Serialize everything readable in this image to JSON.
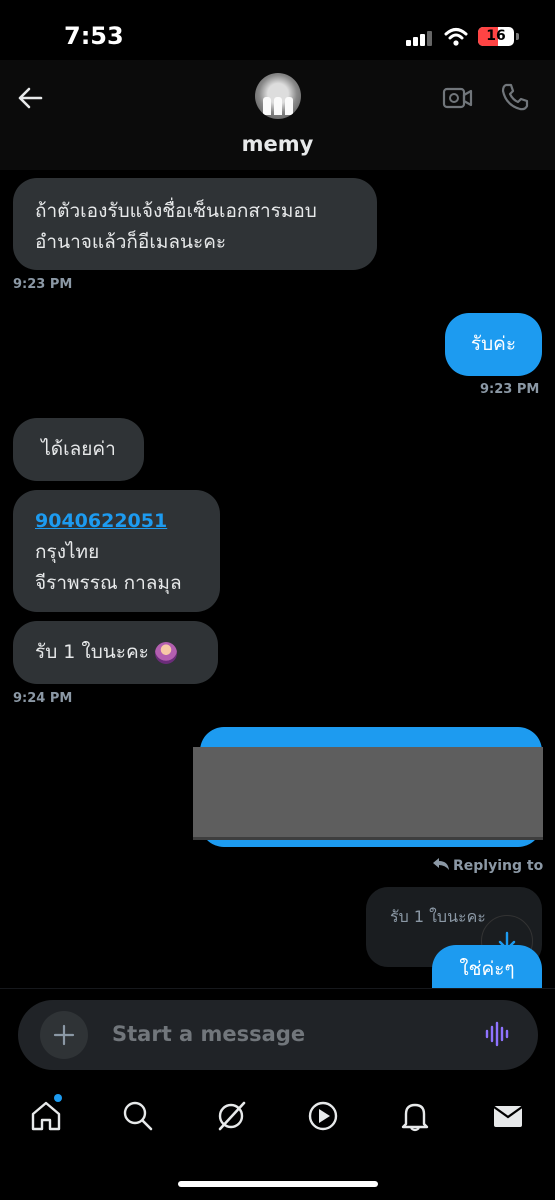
{
  "status_bar": {
    "time": "7:53",
    "battery": "16"
  },
  "header": {
    "contact_name": "memy"
  },
  "messages": [
    {
      "dir": "in",
      "text_lines": [
        "ถ้าตัวเองรับแจ้งชื่อเซ็นเอกสารมอบ",
        "อำนาจแล้วก็อีเมลนะคะ"
      ],
      "timestamp": "9:23 PM"
    },
    {
      "dir": "out",
      "text": "รับค่ะ",
      "timestamp": "9:23 PM"
    },
    {
      "dir": "in",
      "text": "ได้เลยค่า"
    },
    {
      "dir": "in",
      "account_number": "9040622051",
      "bank": "กรุงไทย",
      "name": "จีราพรรณ กาลมุล"
    },
    {
      "dir": "in",
      "text": "รับ 1 ใบนะคะ",
      "timestamp": "9:24 PM"
    },
    {
      "dir": "out",
      "redacted": true
    },
    {
      "dir": "out",
      "reply_label": "Replying to",
      "quoted_text": "รับ 1 ใบนะคะ",
      "text": "ใช่ค่ะๆ"
    }
  ],
  "composer": {
    "placeholder": "Start a message"
  },
  "tabs": [
    {
      "name": "home",
      "icon": "home-icon"
    },
    {
      "name": "search",
      "icon": "search-icon"
    },
    {
      "name": "grok",
      "icon": "grok-icon"
    },
    {
      "name": "video",
      "icon": "play-icon"
    },
    {
      "name": "notifications",
      "icon": "bell-icon"
    },
    {
      "name": "messages",
      "icon": "mail-icon"
    }
  ],
  "colors": {
    "accent": "#1d9bf0",
    "incoming_bubble": "#2f3336",
    "background": "#000000",
    "voice": "#8f73ff"
  }
}
